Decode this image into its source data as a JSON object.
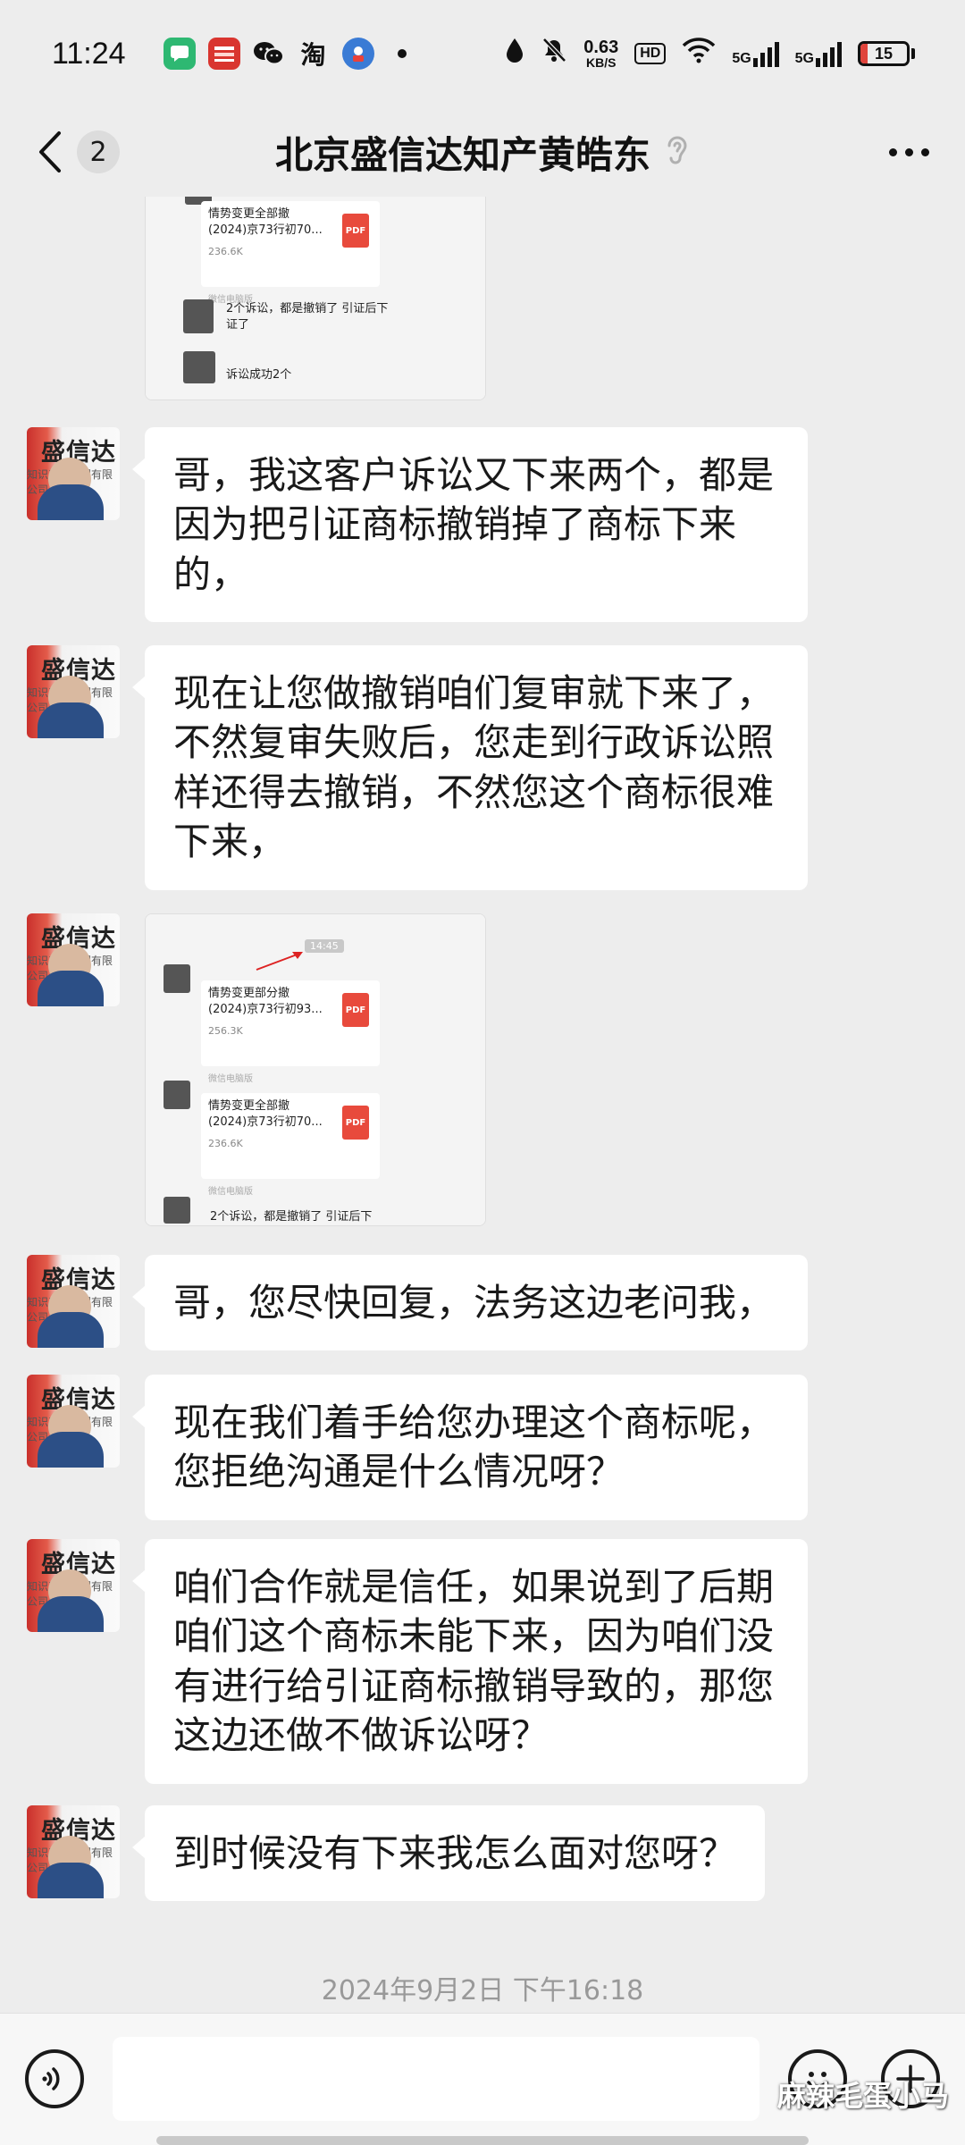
{
  "status_bar": {
    "time": "11:24",
    "app_icons": [
      "messages-icon",
      "red-app-icon",
      "wechat-icon",
      "taobao-icon",
      "blue-app-icon"
    ],
    "taobao_glyph": "淘",
    "net_speed_value": "0.63",
    "net_speed_unit": "KB/S",
    "hd_label": "HD",
    "signal_1": "5G",
    "signal_2": "5G",
    "battery": "15",
    "battery_color": "#e0443c"
  },
  "header": {
    "unread_count": "2",
    "title": "北京盛信达知产黄皓东",
    "title_icon": "ear-icon",
    "more_icon": "more-icon"
  },
  "messages": [
    {
      "type": "image",
      "files": [
        {
          "name": "情势变更全部撤\n(2024)京73行初70...",
          "size": "236.6K",
          "source": "微信电脑版",
          "badge": "PDF"
        }
      ],
      "mini_texts": [
        "2个诉讼，都是撤销了 引证后下证了",
        "诉讼成功2个"
      ]
    },
    {
      "type": "text",
      "text": "哥，我这客户诉讼又下来两个，都是因为把引证商标撤销掉了商标下来的，"
    },
    {
      "type": "text",
      "text": "现在让您做撤销咱们复审就下来了，不然复审失败后，您走到行政诉讼照样还得去撤销，不然您这个商标很难下来，"
    },
    {
      "type": "image",
      "time_chip": "14:45",
      "files": [
        {
          "name": "情势变更部分撤\n(2024)京73行初93...",
          "size": "256.3K",
          "source": "微信电脑版",
          "badge": "PDF"
        },
        {
          "name": "情势变更全部撤\n(2024)京73行初70...",
          "size": "236.6K",
          "source": "微信电脑版",
          "badge": "PDF"
        }
      ],
      "mini_texts": [
        "2个诉讼，都是撤销了 引证后下"
      ]
    },
    {
      "type": "text",
      "text": "哥，您尽快回复，法务这边老问我，"
    },
    {
      "type": "text",
      "text": "现在我们着手给您办理这个商标呢，您拒绝沟通是什么情况呀？"
    },
    {
      "type": "text",
      "text": "咱们合作就是信任，如果说到了后期咱们这个商标未能下来，因为咱们没有进行给引证商标撤销导致的，那您这边还做不做诉讼呀？"
    },
    {
      "type": "text",
      "text": "到时候没有下来我怎么面对您呀？"
    }
  ],
  "avatar": {
    "logo_text": "盛信达",
    "sub_text": "知识产权代理有限公司"
  },
  "timestamp": "2024年9月2日 下午16:18",
  "input_bar": {
    "voice_icon": "voice-icon",
    "input_value": "",
    "emoji_icon": "emoji-icon",
    "plus_icon": "plus-icon"
  },
  "watermark": "麻辣毛蛋小马"
}
